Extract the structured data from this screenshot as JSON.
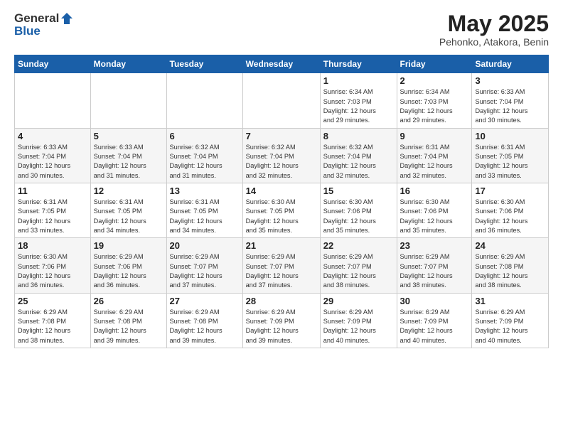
{
  "header": {
    "logo_general": "General",
    "logo_blue": "Blue",
    "month_title": "May 2025",
    "location": "Pehonko, Atakora, Benin"
  },
  "weekdays": [
    "Sunday",
    "Monday",
    "Tuesday",
    "Wednesday",
    "Thursday",
    "Friday",
    "Saturday"
  ],
  "weeks": [
    [
      {
        "day": "",
        "info": ""
      },
      {
        "day": "",
        "info": ""
      },
      {
        "day": "",
        "info": ""
      },
      {
        "day": "",
        "info": ""
      },
      {
        "day": "1",
        "info": "Sunrise: 6:34 AM\nSunset: 7:03 PM\nDaylight: 12 hours\nand 29 minutes."
      },
      {
        "day": "2",
        "info": "Sunrise: 6:34 AM\nSunset: 7:03 PM\nDaylight: 12 hours\nand 29 minutes."
      },
      {
        "day": "3",
        "info": "Sunrise: 6:33 AM\nSunset: 7:04 PM\nDaylight: 12 hours\nand 30 minutes."
      }
    ],
    [
      {
        "day": "4",
        "info": "Sunrise: 6:33 AM\nSunset: 7:04 PM\nDaylight: 12 hours\nand 30 minutes."
      },
      {
        "day": "5",
        "info": "Sunrise: 6:33 AM\nSunset: 7:04 PM\nDaylight: 12 hours\nand 31 minutes."
      },
      {
        "day": "6",
        "info": "Sunrise: 6:32 AM\nSunset: 7:04 PM\nDaylight: 12 hours\nand 31 minutes."
      },
      {
        "day": "7",
        "info": "Sunrise: 6:32 AM\nSunset: 7:04 PM\nDaylight: 12 hours\nand 32 minutes."
      },
      {
        "day": "8",
        "info": "Sunrise: 6:32 AM\nSunset: 7:04 PM\nDaylight: 12 hours\nand 32 minutes."
      },
      {
        "day": "9",
        "info": "Sunrise: 6:31 AM\nSunset: 7:04 PM\nDaylight: 12 hours\nand 32 minutes."
      },
      {
        "day": "10",
        "info": "Sunrise: 6:31 AM\nSunset: 7:05 PM\nDaylight: 12 hours\nand 33 minutes."
      }
    ],
    [
      {
        "day": "11",
        "info": "Sunrise: 6:31 AM\nSunset: 7:05 PM\nDaylight: 12 hours\nand 33 minutes."
      },
      {
        "day": "12",
        "info": "Sunrise: 6:31 AM\nSunset: 7:05 PM\nDaylight: 12 hours\nand 34 minutes."
      },
      {
        "day": "13",
        "info": "Sunrise: 6:31 AM\nSunset: 7:05 PM\nDaylight: 12 hours\nand 34 minutes."
      },
      {
        "day": "14",
        "info": "Sunrise: 6:30 AM\nSunset: 7:05 PM\nDaylight: 12 hours\nand 35 minutes."
      },
      {
        "day": "15",
        "info": "Sunrise: 6:30 AM\nSunset: 7:06 PM\nDaylight: 12 hours\nand 35 minutes."
      },
      {
        "day": "16",
        "info": "Sunrise: 6:30 AM\nSunset: 7:06 PM\nDaylight: 12 hours\nand 35 minutes."
      },
      {
        "day": "17",
        "info": "Sunrise: 6:30 AM\nSunset: 7:06 PM\nDaylight: 12 hours\nand 36 minutes."
      }
    ],
    [
      {
        "day": "18",
        "info": "Sunrise: 6:30 AM\nSunset: 7:06 PM\nDaylight: 12 hours\nand 36 minutes."
      },
      {
        "day": "19",
        "info": "Sunrise: 6:29 AM\nSunset: 7:06 PM\nDaylight: 12 hours\nand 36 minutes."
      },
      {
        "day": "20",
        "info": "Sunrise: 6:29 AM\nSunset: 7:07 PM\nDaylight: 12 hours\nand 37 minutes."
      },
      {
        "day": "21",
        "info": "Sunrise: 6:29 AM\nSunset: 7:07 PM\nDaylight: 12 hours\nand 37 minutes."
      },
      {
        "day": "22",
        "info": "Sunrise: 6:29 AM\nSunset: 7:07 PM\nDaylight: 12 hours\nand 38 minutes."
      },
      {
        "day": "23",
        "info": "Sunrise: 6:29 AM\nSunset: 7:07 PM\nDaylight: 12 hours\nand 38 minutes."
      },
      {
        "day": "24",
        "info": "Sunrise: 6:29 AM\nSunset: 7:08 PM\nDaylight: 12 hours\nand 38 minutes."
      }
    ],
    [
      {
        "day": "25",
        "info": "Sunrise: 6:29 AM\nSunset: 7:08 PM\nDaylight: 12 hours\nand 38 minutes."
      },
      {
        "day": "26",
        "info": "Sunrise: 6:29 AM\nSunset: 7:08 PM\nDaylight: 12 hours\nand 39 minutes."
      },
      {
        "day": "27",
        "info": "Sunrise: 6:29 AM\nSunset: 7:08 PM\nDaylight: 12 hours\nand 39 minutes."
      },
      {
        "day": "28",
        "info": "Sunrise: 6:29 AM\nSunset: 7:09 PM\nDaylight: 12 hours\nand 39 minutes."
      },
      {
        "day": "29",
        "info": "Sunrise: 6:29 AM\nSunset: 7:09 PM\nDaylight: 12 hours\nand 40 minutes."
      },
      {
        "day": "30",
        "info": "Sunrise: 6:29 AM\nSunset: 7:09 PM\nDaylight: 12 hours\nand 40 minutes."
      },
      {
        "day": "31",
        "info": "Sunrise: 6:29 AM\nSunset: 7:09 PM\nDaylight: 12 hours\nand 40 minutes."
      }
    ]
  ]
}
